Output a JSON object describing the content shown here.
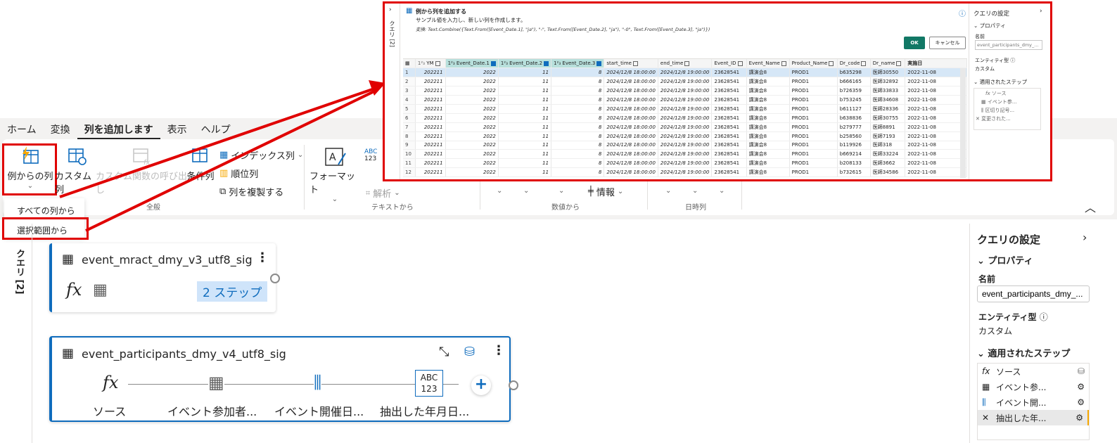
{
  "ribbon": {
    "tabs": [
      "ホーム",
      "変換",
      "列を追加します",
      "表示",
      "ヘルプ"
    ],
    "buttons": {
      "example_col": "例からの列",
      "custom_col": "カスタム列",
      "custom_func": "カスタム関数の呼び出し",
      "cond_col": "条件列",
      "index_col": "インデックス列",
      "rank_col": "順位列",
      "dup_col": "列を複製する",
      "format": "フォーマット",
      "parse": "解析",
      "info": "情報",
      "abc": "ABC",
      "n123": "123"
    },
    "groups": {
      "general": "全般",
      "text": "テキストから",
      "number": "数値から",
      "datetime": "日時列"
    }
  },
  "dropdown": {
    "item1": "すべての列から",
    "item2": "選択範囲から"
  },
  "queries": {
    "label": "クエリ [2]"
  },
  "cards": {
    "card1": {
      "title": "event_mract_dmy_v3_utf8_sig",
      "steps_badge": "2 ステップ"
    },
    "card2": {
      "title": "event_participants_dmy_v4_utf8_sig",
      "steps": [
        "ソース",
        "イベント参加者...",
        "イベント開催日...",
        "抽出した年月日..."
      ],
      "abc": "ABC",
      "n123": "123"
    }
  },
  "settings": {
    "title": "クエリの設定",
    "properties": "プロパティ",
    "name_label": "名前",
    "name_value": "event_participants_dmy_...",
    "entity_label": "エンティティ型",
    "entity_value": "カスタム",
    "applied": "適用されたステップ",
    "steps": [
      "ソース",
      "イベント参...",
      "イベント開...",
      "抽出した年..."
    ]
  },
  "dialog": {
    "title": "例から列を追加する",
    "subtitle": "サンプル値を入力し、新しい列を作成します。",
    "formula": "変換: Text.Combine({Text.From([Event_Date.1], \"ja\"), \"-\", Text.From([Event_Date.2], \"ja\"), \"-0\", Text.From([Event_Date.3], \"ja\")})",
    "ok": "OK",
    "cancel": "キャンセル",
    "queries_label": "クエリ [2]",
    "headers": [
      "YM",
      "Event_Date.1",
      "Event_Date.2",
      "Event_Date.3",
      "start_time",
      "end_time",
      "Event_ID",
      "Event_Name",
      "Product_Name",
      "Dr_code",
      "Dr_name",
      "実施日"
    ],
    "rows": [
      [
        "1",
        "202211",
        "2022",
        "11",
        "8",
        "2024/12/8 18:00:00",
        "2024/12/8 19:00:00",
        "23628541",
        "講演会8",
        "PROD1",
        "b635298",
        "医師30550",
        "2022-11-08"
      ],
      [
        "2",
        "202211",
        "2022",
        "11",
        "8",
        "2024/12/8 18:00:00",
        "2024/12/8 19:00:00",
        "23628541",
        "講演会8",
        "PROD1",
        "b666165",
        "医師32892",
        "2022-11-08"
      ],
      [
        "3",
        "202211",
        "2022",
        "11",
        "8",
        "2024/12/8 18:00:00",
        "2024/12/8 19:00:00",
        "23628541",
        "講演会8",
        "PROD1",
        "b726359",
        "医師33833",
        "2022-11-08"
      ],
      [
        "4",
        "202211",
        "2022",
        "11",
        "8",
        "2024/12/8 18:00:00",
        "2024/12/8 19:00:00",
        "23628541",
        "講演会8",
        "PROD1",
        "b753245",
        "医師34608",
        "2022-11-08"
      ],
      [
        "5",
        "202211",
        "2022",
        "11",
        "8",
        "2024/12/8 18:00:00",
        "2024/12/8 19:00:00",
        "23628541",
        "講演会8",
        "PROD1",
        "b611127",
        "医師28336",
        "2022-11-08"
      ],
      [
        "6",
        "202211",
        "2022",
        "11",
        "8",
        "2024/12/8 18:00:00",
        "2024/12/8 19:00:00",
        "23628541",
        "講演会8",
        "PROD1",
        "b638836",
        "医師30755",
        "2022-11-08"
      ],
      [
        "7",
        "202211",
        "2022",
        "11",
        "8",
        "2024/12/8 18:00:00",
        "2024/12/8 19:00:00",
        "23628541",
        "講演会8",
        "PROD1",
        "b279777",
        "医師8891",
        "2022-11-08"
      ],
      [
        "8",
        "202211",
        "2022",
        "11",
        "8",
        "2024/12/8 18:00:00",
        "2024/12/8 19:00:00",
        "23628541",
        "講演会8",
        "PROD1",
        "b258560",
        "医師7193",
        "2022-11-08"
      ],
      [
        "9",
        "202211",
        "2022",
        "11",
        "8",
        "2024/12/8 18:00:00",
        "2024/12/8 19:00:00",
        "23628541",
        "講演会8",
        "PROD1",
        "b119926",
        "医師318",
        "2022-11-08"
      ],
      [
        "10",
        "202211",
        "2022",
        "11",
        "8",
        "2024/12/8 18:00:00",
        "2024/12/8 19:00:00",
        "23628541",
        "講演会8",
        "PROD1",
        "b669214",
        "医師33224",
        "2022-11-08"
      ],
      [
        "11",
        "202211",
        "2022",
        "11",
        "8",
        "2024/12/8 18:00:00",
        "2024/12/8 19:00:00",
        "23628541",
        "講演会8",
        "PROD1",
        "b208133",
        "医師3662",
        "2022-11-08"
      ],
      [
        "12",
        "202211",
        "2022",
        "11",
        "8",
        "2024/12/8 18:00:00",
        "2024/12/8 19:00:00",
        "23628541",
        "講演会8",
        "PROD1",
        "b732615",
        "医師34586",
        "2022-11-08"
      ]
    ],
    "settings_title": "クエリの設定",
    "properties": "プロパティ",
    "name_label": "名前",
    "name_value": "event_participants_dmy_...",
    "entity_label": "エンティティ型",
    "entity_value": "カスタム",
    "applied": "適用されたステップ",
    "steps": [
      "ソース",
      "イベント参...",
      "区切り記号...",
      "変更された..."
    ]
  },
  "colors": {
    "accent": "#0f6cbd",
    "highlight_border": "#e00000",
    "ok_button": "#117865",
    "teal_header": "#b8e0dc"
  }
}
